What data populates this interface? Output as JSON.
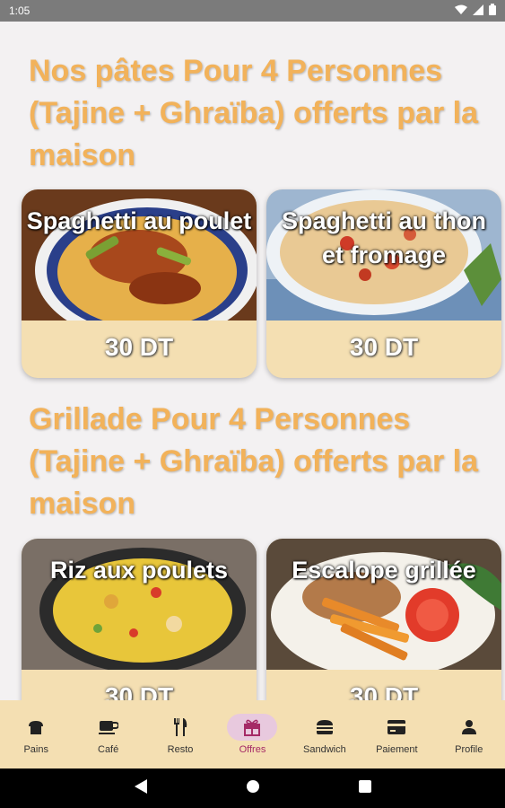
{
  "status": {
    "time": "1:05"
  },
  "sections": [
    {
      "title": "Nos pâtes Pour 4 Personnes (Tajine + Ghraïba) offerts par la maison",
      "items": [
        {
          "name": "Spaghetti au poulet",
          "price": "30 DT"
        },
        {
          "name": "Spaghetti au thon et fromage",
          "price": "30 DT"
        }
      ]
    },
    {
      "title": "Grillade Pour 4 Personnes (Tajine + Ghraïba) offerts par la maison",
      "items": [
        {
          "name": "Riz aux poulets",
          "price": "30 DT"
        },
        {
          "name": "Escalope grillée",
          "price": "30 DT"
        }
      ]
    }
  ],
  "nav": [
    {
      "label": "Pains",
      "icon": "bread-icon",
      "active": false
    },
    {
      "label": "Café",
      "icon": "coffee-cup-icon",
      "active": false
    },
    {
      "label": "Resto",
      "icon": "fork-knife-icon",
      "active": false
    },
    {
      "label": "Offres",
      "icon": "gift-icon",
      "active": true
    },
    {
      "label": "Sandwich",
      "icon": "burger-icon",
      "active": false
    },
    {
      "label": "Paiement",
      "icon": "credit-card-icon",
      "active": false
    },
    {
      "label": "Profile",
      "icon": "person-icon",
      "active": false
    }
  ],
  "colors": {
    "accent": "#f2b25a",
    "card": "#f4dfb2",
    "active": "#a52a66"
  }
}
